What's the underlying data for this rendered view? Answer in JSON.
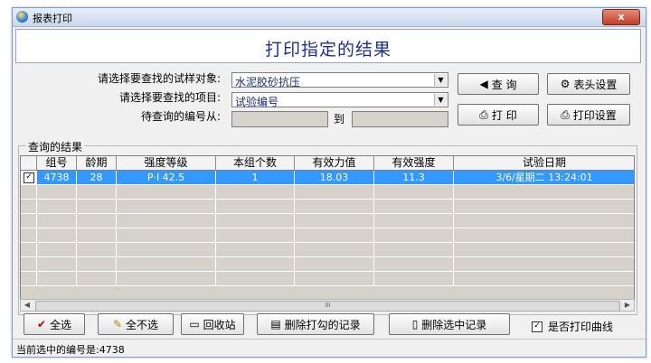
{
  "window": {
    "title": "报表打印",
    "close_symbol": "x"
  },
  "header": {
    "title": "打印指定的结果"
  },
  "query": {
    "object_label": "请选择要查找的试样对象:",
    "object_value": "水泥胶砂抗压",
    "item_label": "请选择要查找的项目:",
    "item_value": "试验编号",
    "range_label": "待查询的编号从:",
    "range_from": "",
    "range_to_label": "到",
    "range_to": ""
  },
  "buttons": {
    "query": "查 询",
    "header_settings": "表头设置",
    "print": "打 印",
    "print_settings": "打印设置"
  },
  "results": {
    "group_label": "查询的结果",
    "columns": [
      "组号",
      "龄期",
      "强度等级",
      "本组个数",
      "有效力值",
      "有效强度",
      "试验日期"
    ],
    "rows": [
      {
        "checked": true,
        "cells": [
          "4738",
          "28",
          "P·I  42.5",
          "1",
          "18.03",
          "11.3",
          "3/6/星期二 13:24:01"
        ]
      }
    ],
    "empty_rows": 7,
    "scroll_thumb": "III"
  },
  "actions": {
    "select_all": "全选",
    "deselect_all": "全不选",
    "recycle": "回收站",
    "delete_checked": "删除打勾的记录",
    "delete_selected": "删除选中记录",
    "print_curve_label": "是否打印曲线",
    "print_curve_checked": true
  },
  "status": {
    "text": "当前选中的编号是:4738"
  }
}
